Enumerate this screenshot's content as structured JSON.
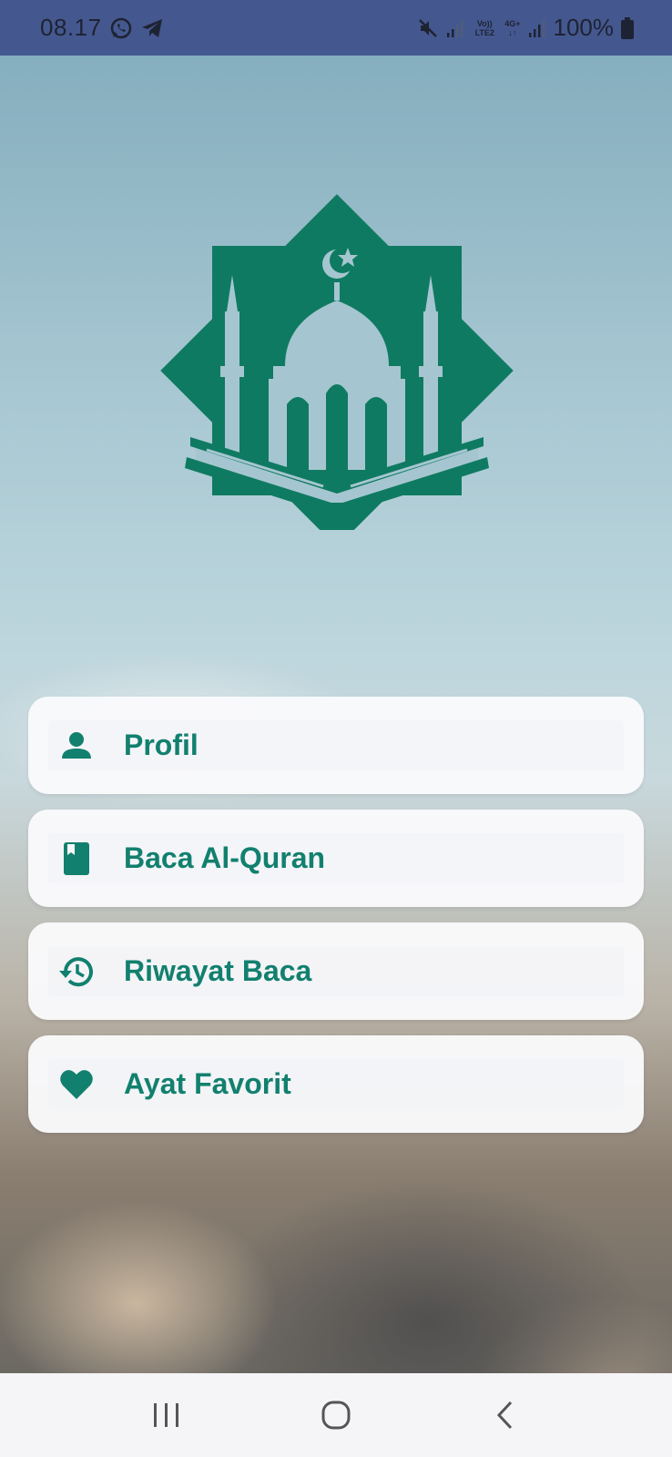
{
  "status_bar": {
    "time": "08.17",
    "volte_label": "Vo)) LTE2",
    "network_label": "4G+",
    "battery": "100%"
  },
  "menu": {
    "items": [
      {
        "label": "Profil",
        "icon": "person-icon"
      },
      {
        "label": "Baca Al-Quran",
        "icon": "book-icon"
      },
      {
        "label": "Riwayat Baca",
        "icon": "history-icon"
      },
      {
        "label": "Ayat Favorit",
        "icon": "heart-icon"
      }
    ]
  },
  "nav_bar": {
    "buttons": [
      "recent-apps",
      "home",
      "back"
    ]
  },
  "colors": {
    "accent": "#12806f",
    "status_bar": "#44588f",
    "logo": "#0f7a62"
  }
}
